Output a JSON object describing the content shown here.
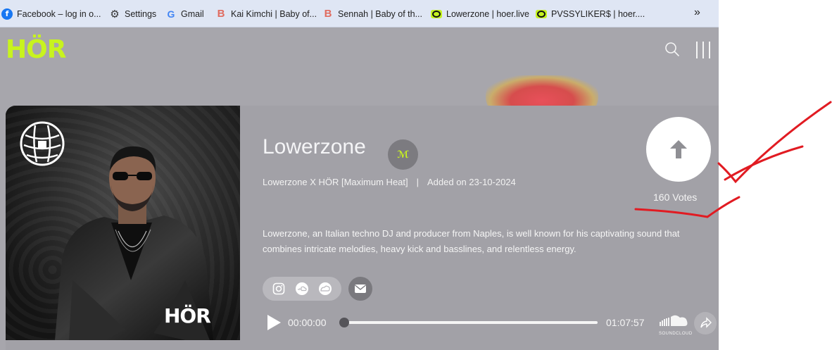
{
  "bookmarks": [
    {
      "label": "Facebook – log in o...",
      "icon": "facebook-icon"
    },
    {
      "label": "Settings",
      "icon": "gear-icon"
    },
    {
      "label": "Gmail",
      "icon": "google-icon"
    },
    {
      "label": "Kai Kimchi | Baby of...",
      "icon": "b-icon"
    },
    {
      "label": "Sennah | Baby of th...",
      "icon": "b-icon"
    },
    {
      "label": "Lowerzone | hoer.live",
      "icon": "hoer-icon"
    },
    {
      "label": "PVSSYLIKER$ | hoer....",
      "icon": "hoer-icon"
    }
  ],
  "bookmarks_more": "»",
  "header": {
    "logo": "HÖR"
  },
  "artist": {
    "name": "Lowerzone",
    "badge": "ℳ",
    "series": "Lowerzone X HÖR [Maximum Heat]",
    "separator": "|",
    "added": "Added on 23-10-2024",
    "description": "Lowerzone, an Italian techno DJ and producer from Naples, is well known for his captivating sound that combines intricate melodies, heavy kick and basslines, and relentless energy."
  },
  "cover": {
    "brand": "HÖR"
  },
  "vote": {
    "count_label": "160 Votes",
    "progress": 0
  },
  "player": {
    "current": "00:00:00",
    "duration": "01:07:57",
    "sc_label": "SOUNDCLOUD"
  },
  "colors": {
    "accent": "#c8f31e",
    "annotation": "#e11b22"
  }
}
